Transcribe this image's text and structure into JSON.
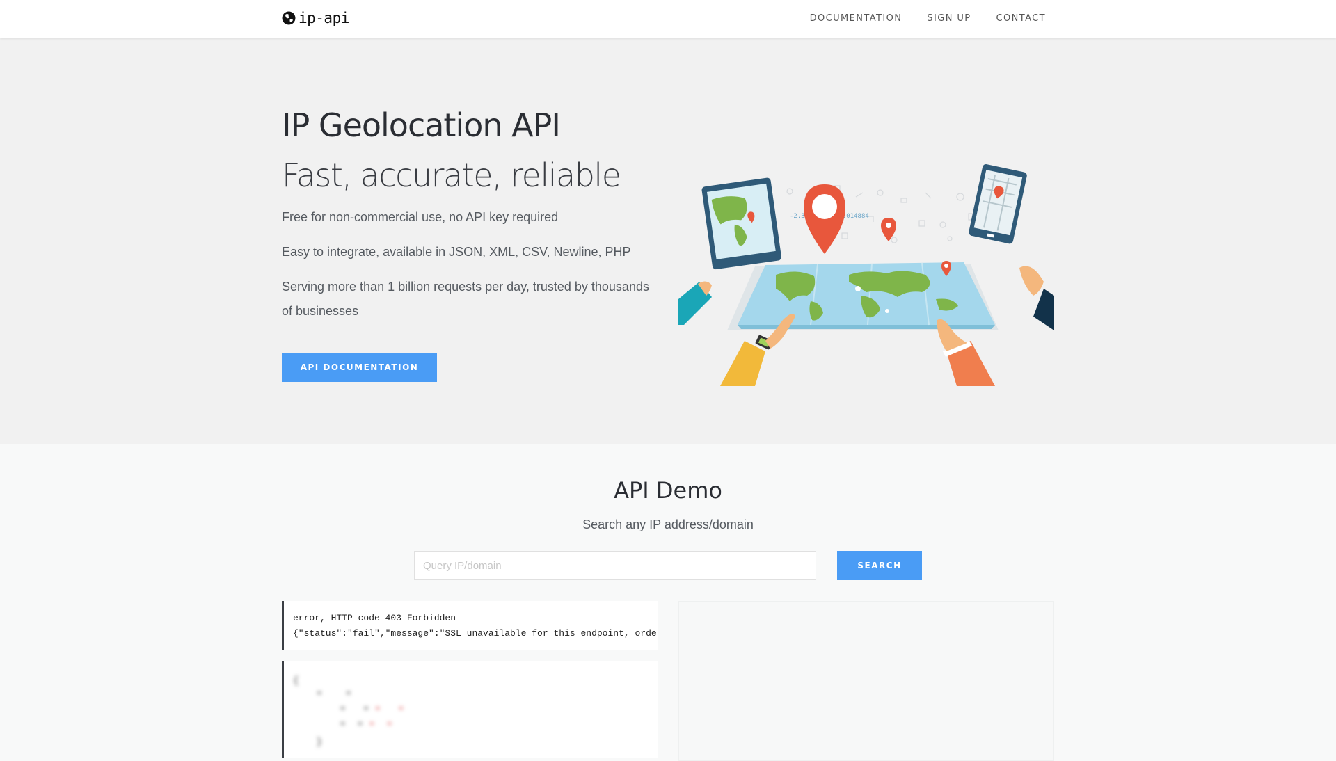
{
  "nav": {
    "logo_text": "ip-api",
    "links": [
      "DOCUMENTATION",
      "SIGN UP",
      "CONTACT"
    ]
  },
  "hero": {
    "title": "IP Geolocation API",
    "subtitle": "Fast, accurate, reliable",
    "lines": [
      "Free for non-commercial use, no API key required",
      "Easy to integrate, available in JSON, XML, CSV, Newline, PHP",
      "Serving more than 1 billion requests per day, trusted by thousands of businesses"
    ],
    "cta_label": "API DOCUMENTATION",
    "illustration_coords": "-2.329799, -52.014884"
  },
  "demo": {
    "title": "API Demo",
    "subtitle": "Search any IP address/domain",
    "query_placeholder": "Query IP/domain",
    "query_value": "",
    "search_label": "SEARCH",
    "error_line_1": "error, HTTP code 403 Forbidden",
    "error_line_2": "{\"status\":\"fail\",\"message\":\"SSL unavailable for this endpoint, order a key at https://members.ip-api.com/\"}"
  },
  "colors": {
    "accent": "#4a9cf5",
    "hero_bg": "#f1f1f1",
    "page_bg": "#f8f9f9"
  }
}
